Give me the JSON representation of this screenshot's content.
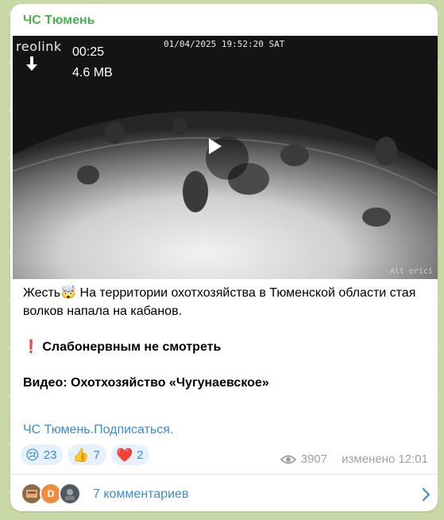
{
  "channel": {
    "name": "ЧС Тюмень"
  },
  "media": {
    "duration": "00:25",
    "size": "4.6 MB",
    "camera_brand": "reolink",
    "camera_timestamp": "01/04/2025 19:52:20 SAT",
    "watermark": "Alt erici"
  },
  "post": {
    "line1": "Жесть🤯 На территории охотхозяйства в Тюменской области стая волков напала на кабанов.",
    "line2_icon": "❗",
    "line2": "Слабонервным не смотреть",
    "line3": "Видео: Охотхозяйство «Чугунаевское»",
    "link": "ЧС Тюмень.Подписаться."
  },
  "reactions": [
    {
      "emoji": "😢",
      "count": "23"
    },
    {
      "emoji": "👍",
      "count": "7"
    },
    {
      "emoji": "❤️",
      "count": "2"
    }
  ],
  "meta": {
    "views": "3907",
    "edited": "изменено 12:01"
  },
  "comments": {
    "label": "7 комментариев",
    "avatar_letter": "D"
  },
  "colors": {
    "accent": "#3a8dd0",
    "channel": "#4caf50",
    "background": "#c9d9a6"
  }
}
